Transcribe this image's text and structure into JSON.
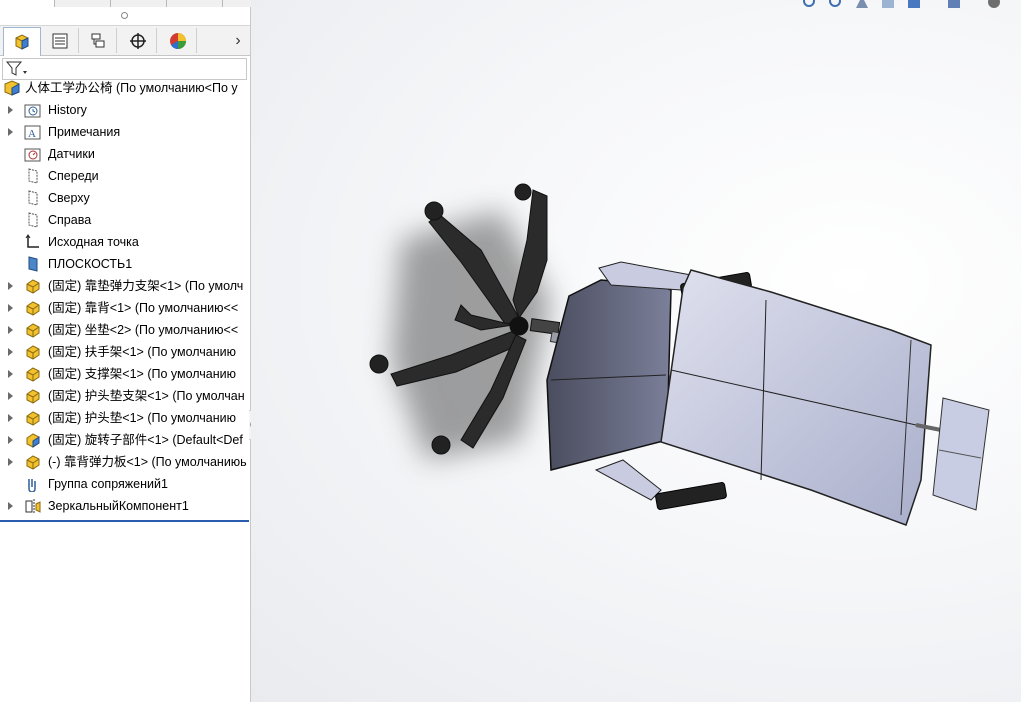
{
  "tree": {
    "root": "人体工学办公椅  (По умолчанию<По у",
    "items": [
      {
        "label": "History",
        "icon": "history-folder-icon",
        "expandable": true
      },
      {
        "label": "Примечания",
        "icon": "annotations-icon",
        "expandable": true
      },
      {
        "label": "Датчики",
        "icon": "sensors-icon",
        "expandable": false
      },
      {
        "label": "Спереди",
        "icon": "plane-icon",
        "expandable": false
      },
      {
        "label": "Сверху",
        "icon": "plane-icon",
        "expandable": false
      },
      {
        "label": "Справа",
        "icon": "plane-icon",
        "expandable": false
      },
      {
        "label": "Исходная точка",
        "icon": "origin-icon",
        "expandable": false
      },
      {
        "label": "ПЛОСКОСТЬ1",
        "icon": "custom-plane-icon",
        "expandable": false
      },
      {
        "label": "(固定) 靠垫弹力支架<1> (По умолч",
        "icon": "part-icon",
        "expandable": true
      },
      {
        "label": "(固定) 靠背<1> (По умолчанию<<",
        "icon": "part-icon",
        "expandable": true
      },
      {
        "label": "(固定) 坐垫<2> (По умолчанию<<",
        "icon": "part-icon",
        "expandable": true
      },
      {
        "label": "(固定) 扶手架<1> (По умолчанию",
        "icon": "part-icon",
        "expandable": true
      },
      {
        "label": "(固定) 支撑架<1> (По умолчанию",
        "icon": "part-icon",
        "expandable": true
      },
      {
        "label": "(固定) 护头垫支架<1> (По умолчан",
        "icon": "part-icon",
        "expandable": true
      },
      {
        "label": "(固定) 护头垫<1> (По умолчанию",
        "icon": "part-icon",
        "expandable": true
      },
      {
        "label": "(固定) 旋转子部件<1> (Default<Def",
        "icon": "subassembly-icon",
        "expandable": true
      },
      {
        "label": "(-) 靠背弹力板<1> (По умолчаниюь",
        "icon": "part-icon",
        "expandable": true
      },
      {
        "label": "Группа сопряжений1",
        "icon": "mates-icon",
        "expandable": false
      },
      {
        "label": "ЗеркальныйКомпонент1",
        "icon": "mirror-component-icon",
        "expandable": true
      }
    ]
  },
  "tabs": [
    {
      "name": "feature-manager-tab",
      "icon": "feature-tree-icon"
    },
    {
      "name": "property-manager-tab",
      "icon": "property-list-icon"
    },
    {
      "name": "configuration-manager-tab",
      "icon": "configuration-icon"
    },
    {
      "name": "dimxpert-tab",
      "icon": "crosshair-icon"
    },
    {
      "name": "display-manager-tab",
      "icon": "appearance-icon"
    }
  ],
  "colors": {
    "selection_line": "#2a5db0",
    "chair_body": "#c9cde3",
    "base_dark": "#2b2b2b"
  }
}
